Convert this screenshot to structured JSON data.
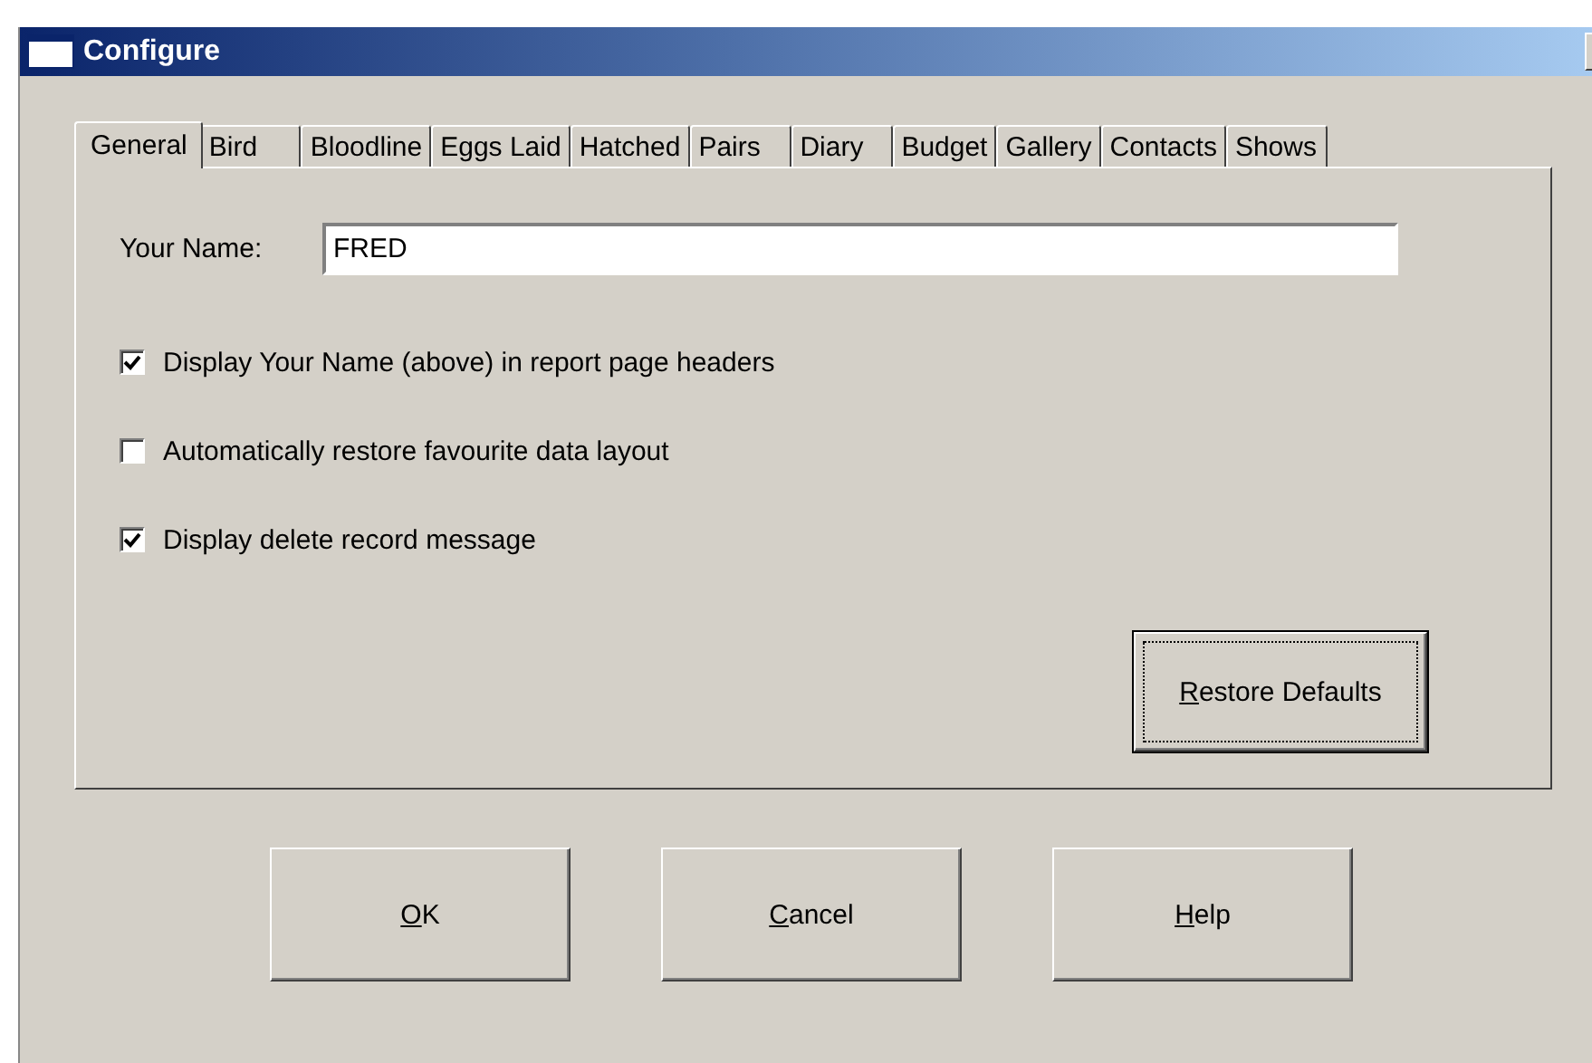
{
  "window": {
    "title": "Configure"
  },
  "tabs": [
    {
      "label": "General",
      "selected": true
    },
    {
      "label": "Bird",
      "selected": false
    },
    {
      "label": "Bloodline",
      "selected": false
    },
    {
      "label": "Eggs Laid",
      "selected": false
    },
    {
      "label": "Hatched",
      "selected": false
    },
    {
      "label": "Pairs",
      "selected": false
    },
    {
      "label": "Diary",
      "selected": false
    },
    {
      "label": "Budget",
      "selected": false
    },
    {
      "label": "Gallery",
      "selected": false
    },
    {
      "label": "Contacts",
      "selected": false
    },
    {
      "label": "Shows",
      "selected": false
    }
  ],
  "name_field": {
    "label": "Your Name:",
    "value": "FRED"
  },
  "options": [
    {
      "label": "Display Your Name (above) in report page headers",
      "checked": true
    },
    {
      "label": "Automatically restore favourite data layout",
      "checked": false
    },
    {
      "label": "Display delete record message",
      "checked": true
    }
  ],
  "restore_button": {
    "label": "Restore Defaults",
    "focused": true,
    "mnemonic_underlined": true
  },
  "buttons": [
    {
      "label": "OK",
      "mnemonic_underlined": true
    },
    {
      "label": "Cancel",
      "mnemonic_underlined": true
    },
    {
      "label": "Help",
      "mnemonic_underlined": true
    }
  ]
}
